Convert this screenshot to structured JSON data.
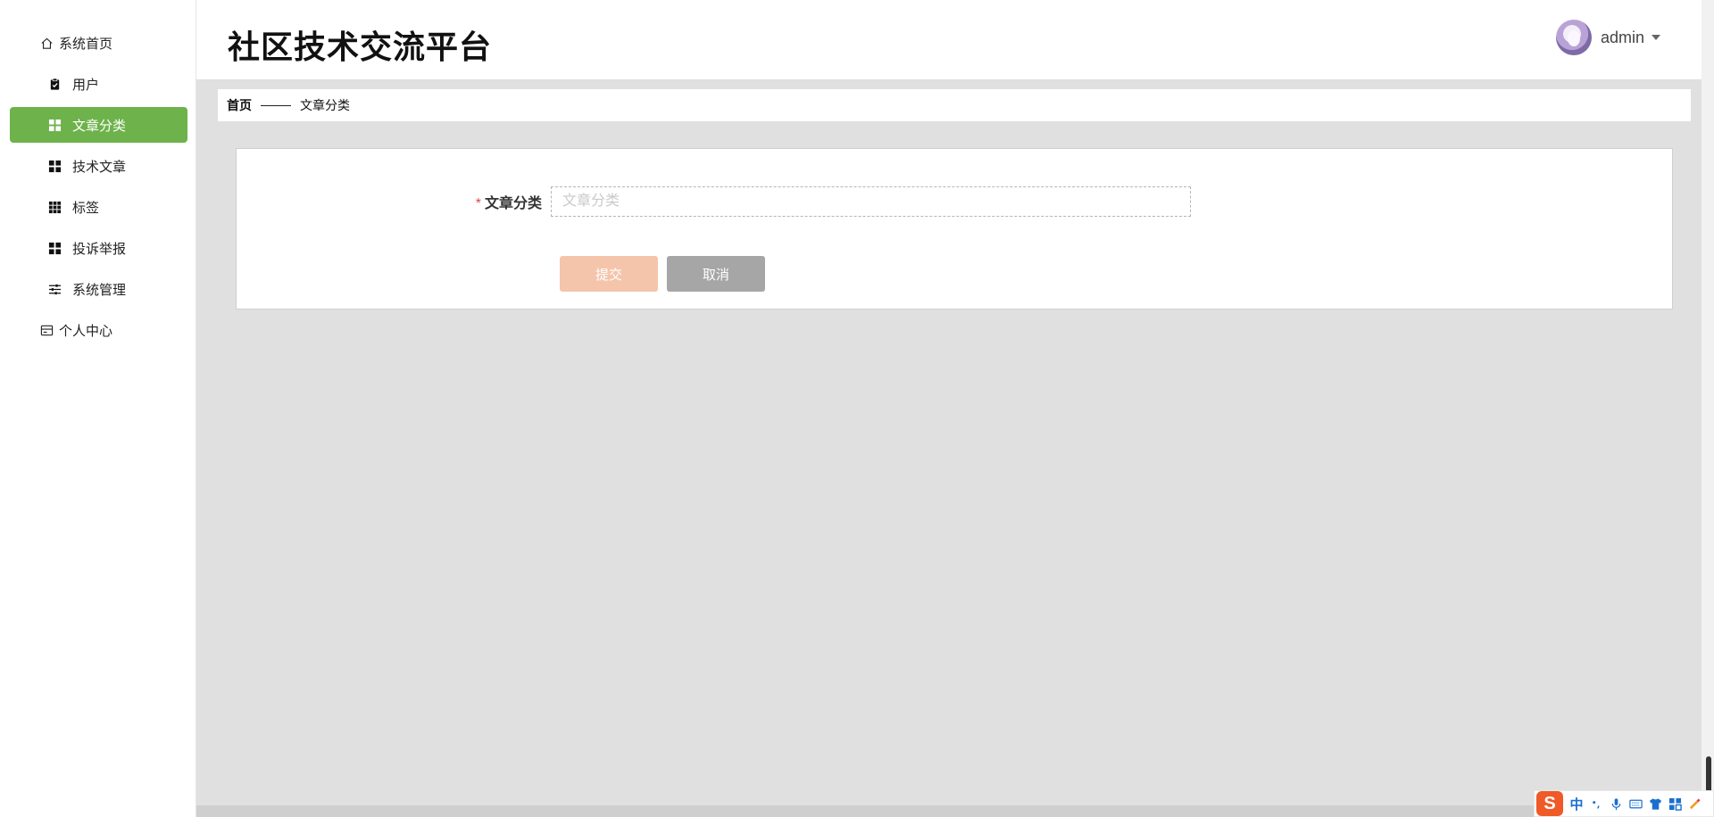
{
  "header": {
    "title": "社区技术交流平台",
    "username": "admin"
  },
  "sidebar": {
    "items": [
      {
        "label": "系统首页",
        "icon": "home-icon"
      },
      {
        "label": "用户",
        "icon": "clipboard-icon"
      },
      {
        "label": "文章分类",
        "icon": "grid-icon",
        "active": true
      },
      {
        "label": "技术文章",
        "icon": "grid-icon"
      },
      {
        "label": "标签",
        "icon": "grid-9-icon"
      },
      {
        "label": "投诉举报",
        "icon": "grid-icon"
      },
      {
        "label": "系统管理",
        "icon": "sliders-icon"
      },
      {
        "label": "个人中心",
        "icon": "card-icon"
      }
    ]
  },
  "breadcrumb": {
    "home": "首页",
    "current": "文章分类"
  },
  "form": {
    "required_mark": "*",
    "label": "文章分类",
    "placeholder": "文章分类",
    "value": "",
    "submit": "提交",
    "cancel": "取消"
  },
  "ime": {
    "logo": "S",
    "mode": "中"
  },
  "colors": {
    "accent": "#6db24a",
    "submit": "#f4c5ab",
    "cancel": "#a6a6a6",
    "required": "#e04b4b",
    "background": "#e0e0e0"
  }
}
